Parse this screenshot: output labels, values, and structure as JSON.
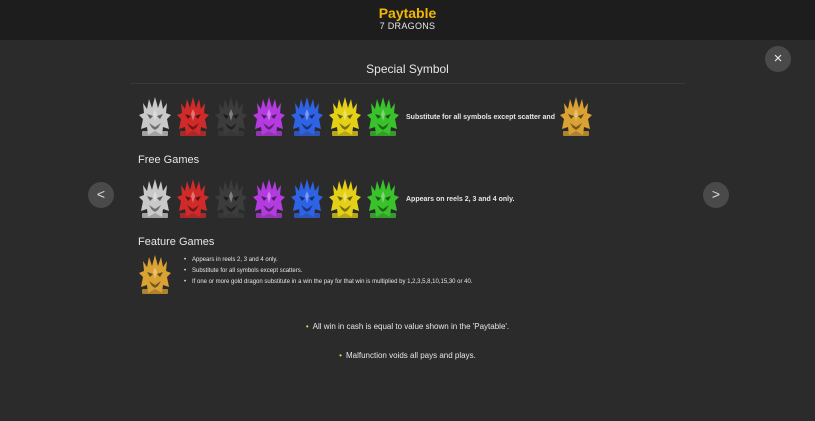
{
  "header": {
    "title": "Paytable",
    "subtitle": "7 DRAGONS"
  },
  "close_icon": "×",
  "nav": {
    "prev": "<",
    "next": ">"
  },
  "special": {
    "title": "Special Symbol",
    "text": "Substitute for all symbols except scatter and"
  },
  "free_games": {
    "label": "Free Games",
    "text": "Appears on reels 2, 3 and 4 only."
  },
  "feature_games": {
    "label": "Feature Games",
    "items": [
      "Appears in reels 2, 3 and 4 only.",
      "Substitute for all symbols except scatters.",
      "If one or more gold dragon substitute in a win the pay for that win is multiplied by 1,2,3,5,8,10,15,30 or 40."
    ]
  },
  "notes": [
    "All win in cash is equal to value shown in the 'Paytable'.",
    "Malfunction voids all pays and plays."
  ],
  "dragon_colors": {
    "silver": "#c9c9c9",
    "red": "#d12a2a",
    "black": "#3c3c3c",
    "purple": "#b43be0",
    "blue": "#2f63e6",
    "yellow": "#e4d016",
    "green": "#39c22c",
    "gold": "#d9a233"
  },
  "accent": "#f2b705"
}
